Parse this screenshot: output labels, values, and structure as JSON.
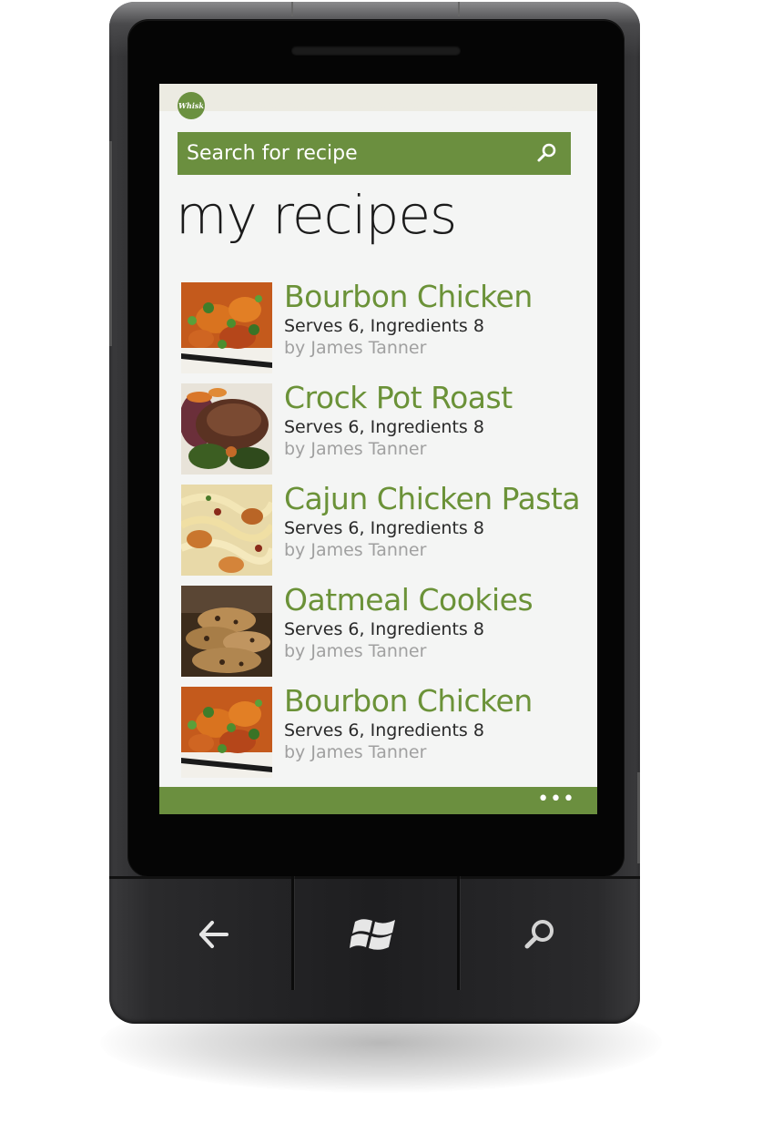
{
  "app": {
    "logo_text": "Whisk",
    "search": {
      "placeholder": "Search for recipe",
      "icon": "search-icon"
    },
    "page_title": "my recipes",
    "recipes": [
      {
        "title": "Bourbon Chicken",
        "meta": "Serves 6, Ingredients 8",
        "author": "by James Tanner",
        "image": "bourbon-chicken-photo"
      },
      {
        "title": "Crock Pot Roast",
        "meta": "Serves 6, Ingredients 8",
        "author": "by James Tanner",
        "image": "pot-roast-photo"
      },
      {
        "title": "Cajun Chicken Pasta",
        "meta": "Serves 6, Ingredients 8",
        "author": "by James Tanner",
        "image": "cajun-pasta-photo"
      },
      {
        "title": "Oatmeal Cookies",
        "meta": "Serves 6, Ingredients 8",
        "author": "by James Tanner",
        "image": "oatmeal-cookies-photo"
      },
      {
        "title": "Bourbon Chicken",
        "meta": "Serves 6, Ingredients 8",
        "author": "by James Tanner",
        "image": "bourbon-chicken-photo"
      }
    ],
    "app_bar": {
      "more_label": "•••"
    }
  },
  "hardware_buttons": [
    {
      "icon": "back-arrow-icon"
    },
    {
      "icon": "windows-logo-icon"
    },
    {
      "icon": "search-icon"
    }
  ],
  "colors": {
    "accent_green": "#6b8f3f",
    "title_green": "#6b9238",
    "author_gray": "#a0a0a0",
    "screen_background": "#f4f5f4"
  }
}
